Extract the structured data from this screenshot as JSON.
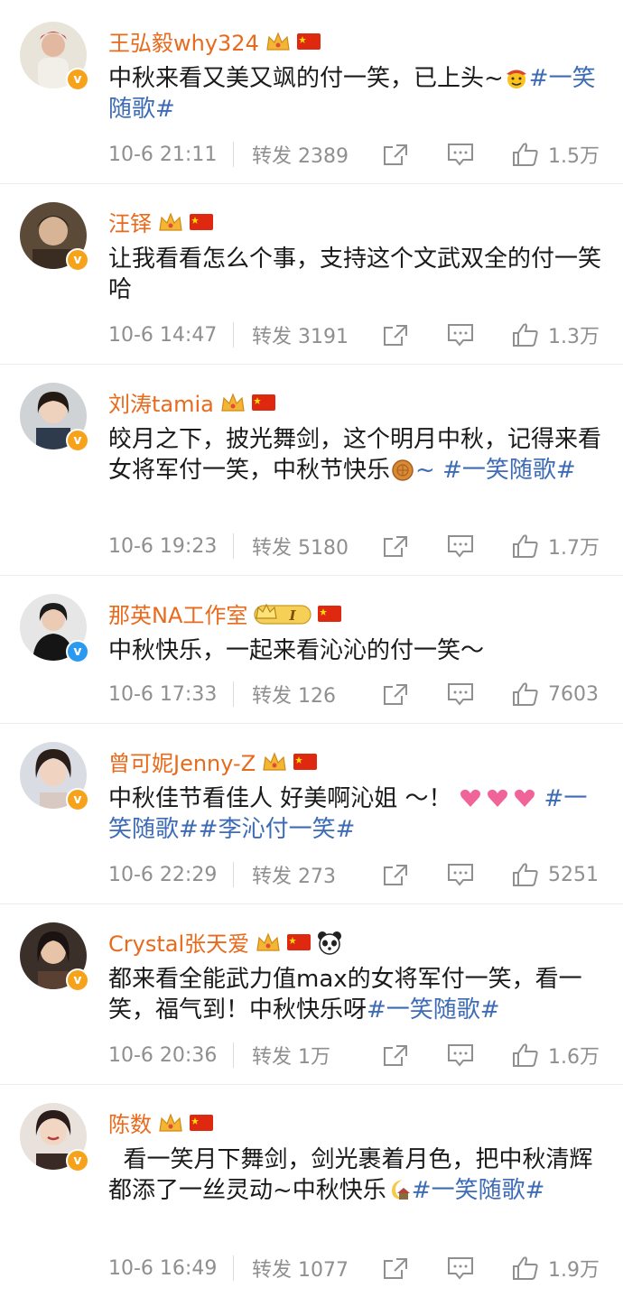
{
  "posts": [
    {
      "username": "王弘毅why324",
      "verify": "orange",
      "badges": [
        "crown-icon",
        "china-flag-icon"
      ],
      "text_before": "中秋来看又美又飒的付一笑，已上头~",
      "emoji": "cowboy-emoji-icon",
      "hashtag": "#一笑随歌#",
      "text_after": "",
      "time": "10-6 21:11",
      "repost": "转发 2389",
      "likes": "1.5万"
    },
    {
      "username": "汪铎",
      "verify": "orange",
      "badges": [
        "crown-icon",
        "china-flag-icon"
      ],
      "text_before": "让我看看怎么个事，支持这个文武双全的付一笑哈",
      "emoji": "",
      "hashtag": "",
      "text_after": "",
      "time": "10-6 14:47",
      "repost": "转发 3191",
      "likes": "1.3万"
    },
    {
      "username": "刘涛tamia",
      "verify": "orange",
      "badges": [
        "crown-icon",
        "china-flag-icon"
      ],
      "text_before": "皎月之下，披光舞剑，这个明月中秋，记得来看女将军付一笑，中秋节快乐",
      "emoji": "mooncake-emoji-icon",
      "hashtag": "~ #一笑随歌#",
      "text_after": "",
      "time": "10-6 19:23",
      "repost": "转发 5180",
      "likes": "1.7万"
    },
    {
      "username": "那英NA工作室",
      "verify": "blue",
      "badges": [
        "vip-level-badge-icon",
        "china-flag-icon"
      ],
      "vip_level": "I",
      "text_before": "中秋快乐，一起来看沁沁的付一笑～",
      "emoji": "",
      "hashtag": "",
      "text_after": "",
      "time": "10-6 17:33",
      "repost": "转发 126",
      "likes": "7603"
    },
    {
      "username": "曾可妮Jenny-Z",
      "verify": "orange",
      "badges": [
        "crown-icon",
        "china-flag-icon"
      ],
      "text_before": "中秋佳节看佳人 好美啊沁姐 ～！",
      "emoji": "hearts-emoji-icon",
      "hashtag": "#一笑随歌##李沁付一笑#",
      "text_after": "",
      "time": "10-6 22:29",
      "repost": "转发 273",
      "likes": "5251"
    },
    {
      "username": "Crystal张天爱",
      "verify": "orange",
      "badges": [
        "crown-icon",
        "china-flag-icon",
        "panda-icon"
      ],
      "text_before": "都来看全能武力值max的女将军付一笑，看一笑，福气到！中秋快乐呀",
      "emoji": "",
      "hashtag": "#一笑随歌#",
      "text_after": "",
      "time": "10-6 20:36",
      "repost": "转发 1万",
      "likes": "1.6万"
    },
    {
      "username": "陈数",
      "verify": "orange",
      "badges": [
        "crown-icon",
        "china-flag-icon"
      ],
      "text_before": "  看一笑月下舞剑，剑光裹着月色，把中秋清辉都添了一丝灵动~中秋快乐",
      "emoji": "moon-emoji-icon",
      "hashtag": "#一笑随歌#",
      "text_after": "",
      "time": "10-6 16:49",
      "repost": "转发 1077",
      "likes": "1.9万"
    }
  ],
  "colors": {
    "username": "#e86a1d",
    "hashtag": "#3d6bb5",
    "meta": "#8f8f8f",
    "verify_orange": "#f7a21b",
    "verify_blue": "#2a9af0"
  }
}
